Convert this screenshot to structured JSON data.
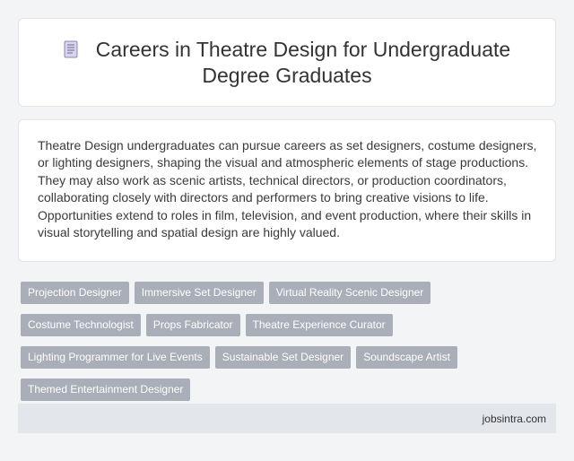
{
  "header": {
    "icon": "document-icon",
    "title": "Careers in Theatre Design for Undergraduate Degree Graduates"
  },
  "summary": {
    "text": "Theatre Design undergraduates can pursue careers as set designers, costume designers, or lighting designers, shaping the visual and atmospheric elements of stage productions. They may also work as scenic artists, technical directors, or production coordinators, collaborating closely with directors and performers to bring creative visions to life. Opportunities extend to roles in film, television, and event production, where their skills in visual storytelling and spatial design are highly valued."
  },
  "tags": [
    "Projection Designer",
    "Immersive Set Designer",
    "Virtual Reality Scenic Designer",
    "Costume Technologist",
    "Props Fabricator",
    "Theatre Experience Curator",
    "Lighting Programmer for Live Events",
    "Sustainable Set Designer",
    "Soundscape Artist",
    "Themed Entertainment Designer"
  ],
  "footer": {
    "site": "jobsintra.com"
  },
  "colors": {
    "tag_background": "#a9aeb8",
    "footer_background": "#e3e6eb",
    "page_background": "#f3f4f6"
  }
}
